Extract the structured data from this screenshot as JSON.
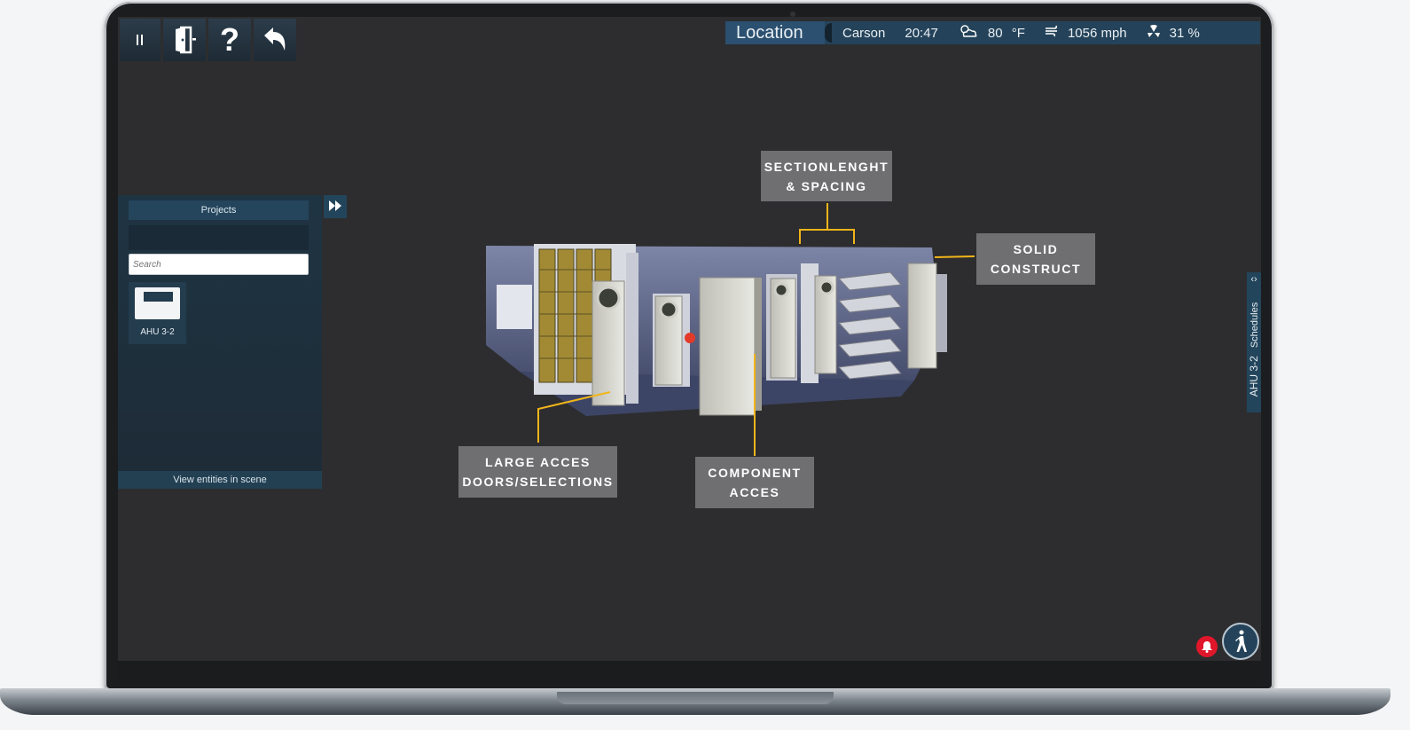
{
  "toolbar": {
    "pause_icon": "pause-icon",
    "exit_icon": "exit-door-icon",
    "help_icon": "help-icon",
    "undo_icon": "undo-icon"
  },
  "status": {
    "location_label": "Location",
    "city": "Carson",
    "time": "20:47",
    "temperature": "80",
    "temperature_unit": "°F",
    "wind": "1056 mph",
    "humidity": "31 %"
  },
  "panel": {
    "header": "Projects",
    "search_placeholder": "Search",
    "items": [
      {
        "label": "AHU 3-2"
      }
    ],
    "footer": "View entities in scene"
  },
  "callouts": {
    "section": "SECTIONLENGHT\n& SPACING",
    "solid": "SOLID\nCONSTRUCT",
    "large": "LARGE ACCES\nDOORS/SELECTIONS",
    "component": "COMPONENT\nACCES"
  },
  "side_tab": {
    "title": "AHU 3-2",
    "label": "Schedules"
  },
  "colors": {
    "accent": "#f2b519",
    "panel": "#1f3443",
    "callout_bg": "#6f6f72",
    "alert": "#e0162b"
  }
}
